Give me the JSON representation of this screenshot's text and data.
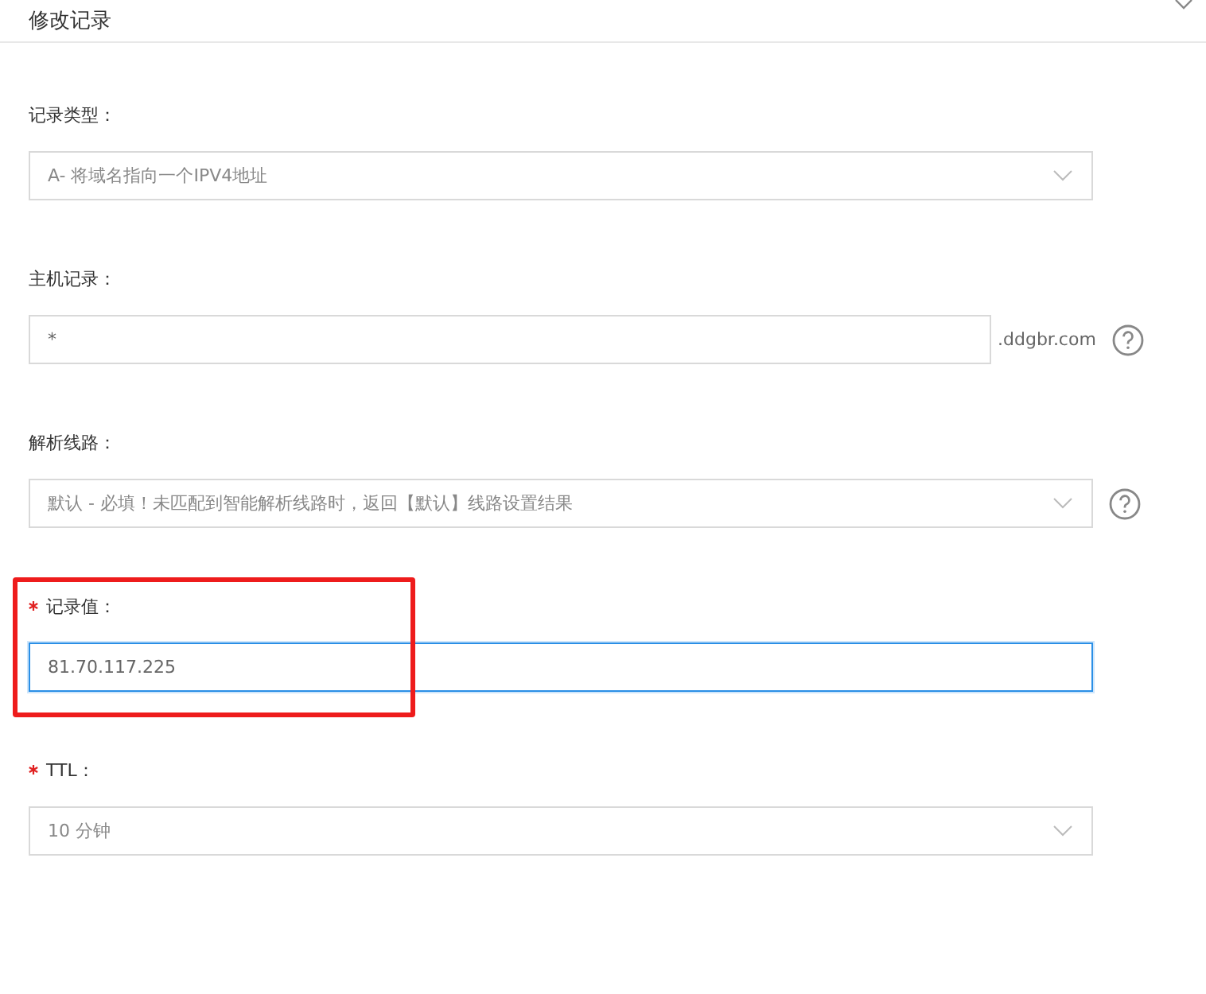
{
  "dialog": {
    "title": "修改记录"
  },
  "fields": [
    {
      "kind": "select",
      "label": "记录类型：",
      "required": false,
      "value": "A- 将域名指向一个IPV4地址",
      "focused": false,
      "highlighted": false,
      "help": false
    },
    {
      "kind": "input",
      "label": "主机记录：",
      "required": false,
      "value": "*",
      "suffix": ".ddgbr.com",
      "focused": false,
      "highlighted": false,
      "help": true
    },
    {
      "kind": "select",
      "label": "解析线路：",
      "required": false,
      "value": "默认 - 必填！未匹配到智能解析线路时，返回【默认】线路设置结果",
      "focused": false,
      "highlighted": false,
      "help": true
    },
    {
      "kind": "input",
      "label": "记录值：",
      "required": true,
      "value": "81.70.117.225",
      "focused": true,
      "highlighted": true,
      "help": false
    },
    {
      "kind": "select",
      "label": "TTL：",
      "required": true,
      "value": "10 分钟",
      "focused": false,
      "highlighted": false,
      "help": false
    }
  ]
}
